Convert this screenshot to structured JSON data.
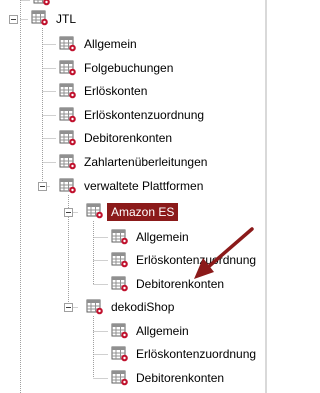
{
  "tree": {
    "root_label": "JTL",
    "items": [
      {
        "label": "Allgemein"
      },
      {
        "label": "Folgebuchungen"
      },
      {
        "label": "Erlöskonten"
      },
      {
        "label": "Erlöskontenzuordnung"
      },
      {
        "label": "Debitorenkonten"
      },
      {
        "label": "Zahlartenüberleitungen"
      },
      {
        "label": "verwaltete Plattformen"
      }
    ],
    "amazon": {
      "label": "Amazon ES",
      "children": [
        {
          "label": "Allgemein"
        },
        {
          "label": "Erlöskontenzuordnung"
        },
        {
          "label": "Debitorenkonten"
        }
      ]
    },
    "dekodi": {
      "label": "dekodiShop",
      "children": [
        {
          "label": "Allgemein"
        },
        {
          "label": "Erlöskontenzuordnung"
        },
        {
          "label": "Debitorenkonten"
        }
      ]
    }
  },
  "colors": {
    "selection": "#8b1a1a",
    "arrow": "#8b1a1a",
    "dotted_line": "#a0a0a0"
  },
  "icons": {
    "node": "table-gear-icon"
  }
}
